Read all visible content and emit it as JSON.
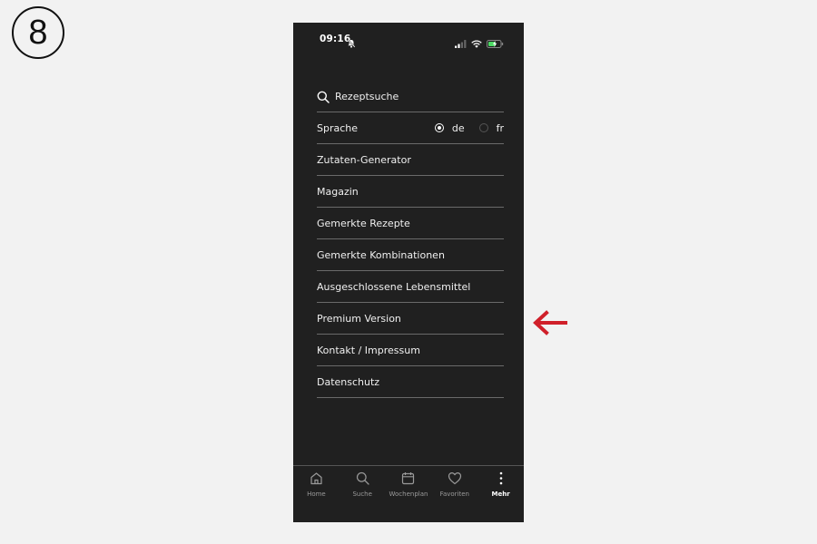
{
  "step_badge": "8",
  "status_bar": {
    "time": "09:16",
    "icons": [
      "bell-muted-icon",
      "signal-icon",
      "wifi-icon",
      "battery-charging-icon"
    ]
  },
  "menu": {
    "search_label": "Rezeptsuche",
    "language": {
      "label": "Sprache",
      "options": [
        {
          "label": "de",
          "selected": true
        },
        {
          "label": "fr",
          "selected": false
        }
      ]
    },
    "items": [
      "Zutaten-Generator",
      "Magazin",
      "Gemerkte Rezepte",
      "Gemerkte Kombinationen",
      "Ausgeschlossene Lebensmittel",
      "Premium Version",
      "Kontakt / Impressum",
      "Datenschutz"
    ]
  },
  "tab_bar": {
    "tabs": [
      {
        "label": "Home",
        "icon": "home-icon",
        "active": false
      },
      {
        "label": "Suche",
        "icon": "search-icon",
        "active": false
      },
      {
        "label": "Wochenplan",
        "icon": "calendar-icon",
        "active": false
      },
      {
        "label": "Favoriten",
        "icon": "heart-icon",
        "active": false
      },
      {
        "label": "Mehr",
        "icon": "more-vertical-icon",
        "active": true
      }
    ]
  },
  "annotation": {
    "arrow_color": "#d0202a",
    "points_to": "Premium Version"
  },
  "colors": {
    "phone_background": "#202020",
    "page_background": "#f2f2f2",
    "divider": "#6a6a6a",
    "battery_charging": "#4cd964"
  }
}
